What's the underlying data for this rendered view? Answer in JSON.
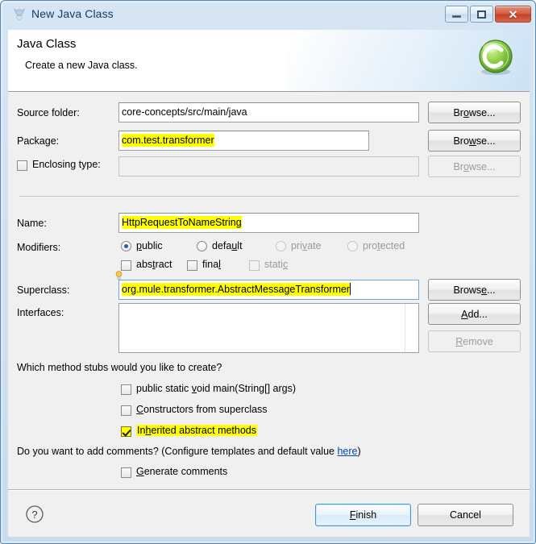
{
  "window": {
    "title": "New Java Class",
    "icon": "java-class-wizard-icon",
    "controls": {
      "minimize": "minimize-icon",
      "maximize": "maximize-icon",
      "close": "close-icon"
    }
  },
  "header": {
    "title": "Java Class",
    "subtitle": "Create a new Java class.",
    "icon": "green-class-circle-icon"
  },
  "form": {
    "source_folder": {
      "label": "Source folder:",
      "value": "core-concepts/src/main/java",
      "highlighted": false,
      "browse": "Browse..."
    },
    "package": {
      "label": "Package:",
      "value": "com.test.transformer",
      "highlighted": true,
      "browse": "Browse..."
    },
    "enclosing_type": {
      "label": "Enclosing type:",
      "value": "",
      "checked": false,
      "enabled": false,
      "browse": "Browse..."
    },
    "name": {
      "label": "Name:",
      "value": "HttpRequestToNameString",
      "highlighted": true
    },
    "modifiers": {
      "label": "Modifiers:",
      "radios": [
        {
          "label": "public",
          "selected": true,
          "enabled": true,
          "mnemonic": "p"
        },
        {
          "label": "default",
          "selected": false,
          "enabled": true,
          "mnemonic": "u"
        },
        {
          "label": "private",
          "selected": false,
          "enabled": false,
          "mnemonic": "v"
        },
        {
          "label": "protected",
          "selected": false,
          "enabled": false,
          "mnemonic": "t"
        }
      ],
      "checkboxes": [
        {
          "label": "abstract",
          "checked": false,
          "enabled": true,
          "mnemonic": "t"
        },
        {
          "label": "final",
          "checked": false,
          "enabled": true,
          "mnemonic": "l"
        },
        {
          "label": "static",
          "checked": false,
          "enabled": false,
          "mnemonic": "c"
        }
      ]
    },
    "superclass": {
      "label": "Superclass:",
      "value": "org.mule.transformer.AbstractMessageTransformer",
      "highlighted": true,
      "focused": true,
      "has_caret": true,
      "hint_icon": "lightbulb-icon",
      "browse": "Browse..."
    },
    "interfaces": {
      "label": "Interfaces:",
      "items": [],
      "add": "Add...",
      "remove": "Remove",
      "remove_enabled": false
    }
  },
  "stubs": {
    "question": "Which method stubs would you like to create?",
    "options": [
      {
        "label": "public static void main(String[] args)",
        "checked": false,
        "highlighted": false
      },
      {
        "label": "Constructors from superclass",
        "checked": false,
        "highlighted": false
      },
      {
        "label": "Inherited abstract methods",
        "checked": true,
        "highlighted": true
      }
    ]
  },
  "comments": {
    "question_before": "Do you want to add comments? (Configure templates and default value ",
    "link": "here",
    "question_after": ")",
    "option": {
      "label": "Generate comments",
      "checked": false
    }
  },
  "footer": {
    "help_icon": "help-question-icon",
    "finish": "Finish",
    "cancel": "Cancel"
  },
  "colors": {
    "highlight": "#ffff00",
    "link": "#0645ad",
    "accent": "#3c9ad4",
    "close_button": "#bf4026"
  }
}
